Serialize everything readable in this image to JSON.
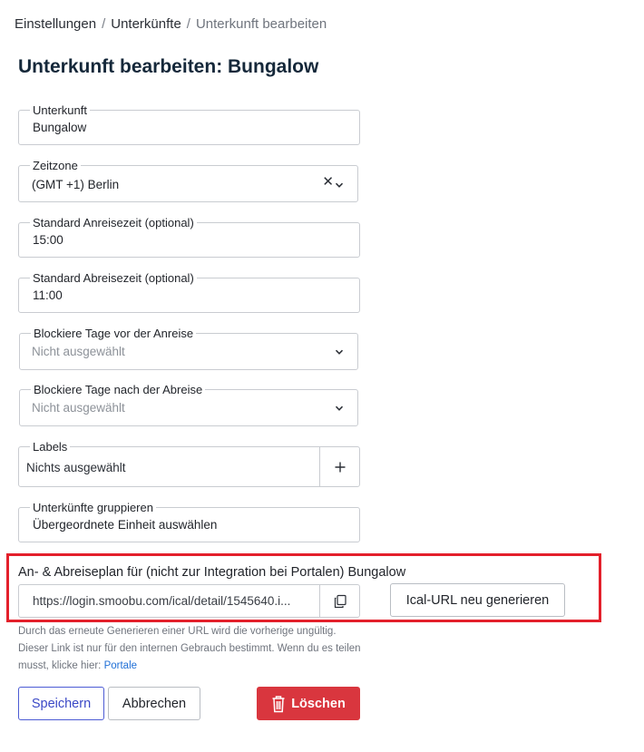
{
  "breadcrumb": {
    "items": [
      "Einstellungen",
      "Unterkünfte",
      "Unterkunft bearbeiten"
    ],
    "separator": "/"
  },
  "page_title": "Unterkunft bearbeiten: Bungalow",
  "form": {
    "accommodation": {
      "label": "Unterkunft",
      "value": "Bungalow"
    },
    "timezone": {
      "label": "Zeitzone",
      "value": "(GMT +1) Berlin",
      "clear_glyph": "✕"
    },
    "arrival_time": {
      "label": "Standard Anreisezeit (optional)",
      "value": "15:00"
    },
    "departure_time": {
      "label": "Standard Abreisezeit (optional)",
      "value": "11:00"
    },
    "block_before": {
      "label": "Blockiere Tage vor der Anreise",
      "placeholder": "Nicht ausgewählt"
    },
    "block_after": {
      "label": "Blockiere Tage nach der Abreise",
      "placeholder": "Nicht ausgewählt"
    },
    "labels": {
      "label": "Labels",
      "placeholder": "Nichts ausgewählt",
      "add_glyph": "+"
    },
    "group": {
      "label": "Unterkünfte gruppieren",
      "placeholder": "Übergeordnete Einheit auswählen"
    }
  },
  "ical": {
    "title": "An- & Abreiseplan für (nicht zur Integration bei Portalen) Bungalow",
    "url": "https://login.smoobu.com/ical/detail/1545640.i...",
    "regenerate_label": "Ical-URL neu generieren",
    "help_line1": "Durch das erneute Generieren einer URL wird die vorherige ungültig.",
    "help_line2": "Dieser Link ist nur für den internen Gebrauch bestimmt. Wenn du es teilen musst, klicke hier:",
    "help_link": "Portale"
  },
  "actions": {
    "save": "Speichern",
    "cancel": "Abbrechen",
    "delete": "Löschen"
  },
  "colors": {
    "primary": "#3a48c6",
    "danger": "#d9363e",
    "highlight": "#e3202b",
    "link": "#1f6fd6",
    "title": "#15283a"
  }
}
